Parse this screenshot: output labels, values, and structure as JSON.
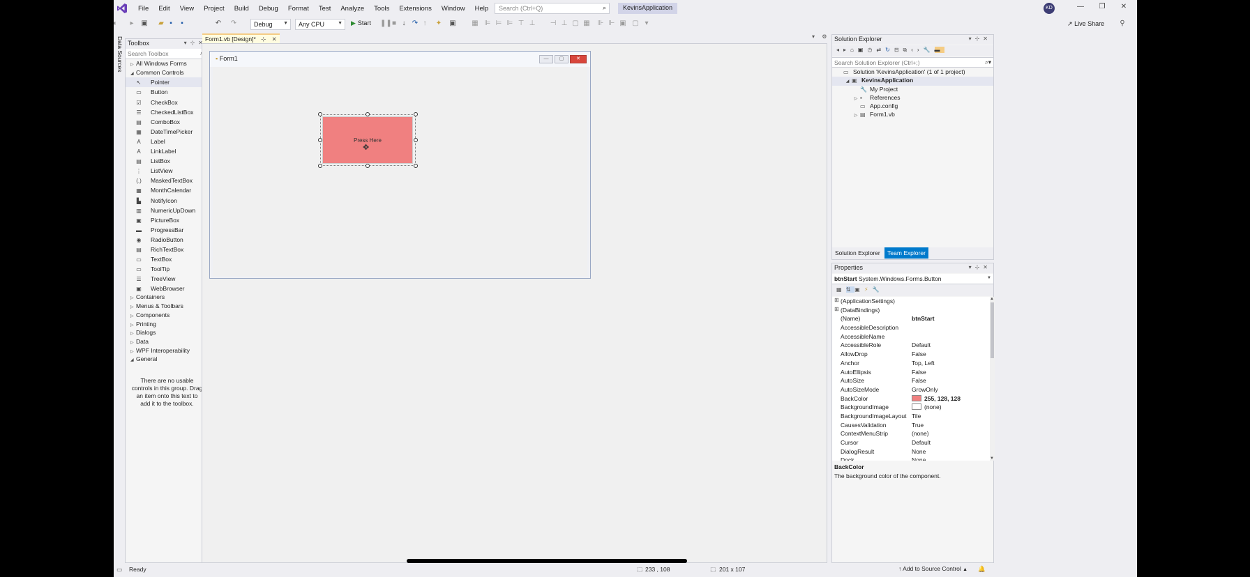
{
  "titlebar": {
    "menu": [
      "File",
      "Edit",
      "View",
      "Project",
      "Build",
      "Debug",
      "Format",
      "Test",
      "Analyze",
      "Tools",
      "Extensions",
      "Window",
      "Help"
    ],
    "search_placeholder": "Search (Ctrl+Q)",
    "project_name": "KevinsApplication",
    "avatar_initials": "KD"
  },
  "toolbar": {
    "config": "Debug",
    "platform": "Any CPU",
    "start_label": "Start",
    "live_share": "Live Share"
  },
  "leftstrip": {
    "label": "Data Sources"
  },
  "toolbox": {
    "title": "Toolbox",
    "search_placeholder": "Search Toolbox",
    "categories_top": [
      {
        "label": "All Windows Forms",
        "expanded": false
      },
      {
        "label": "Common Controls",
        "expanded": true
      }
    ],
    "items": [
      {
        "label": "Pointer",
        "icon": "pointer-icon",
        "glyph": "↖"
      },
      {
        "label": "Button",
        "icon": "button-icon",
        "glyph": "▭"
      },
      {
        "label": "CheckBox",
        "icon": "checkbox-icon",
        "glyph": "☑"
      },
      {
        "label": "CheckedListBox",
        "icon": "checkedlistbox-icon",
        "glyph": "☰"
      },
      {
        "label": "ComboBox",
        "icon": "combobox-icon",
        "glyph": "▤"
      },
      {
        "label": "DateTimePicker",
        "icon": "datetimepicker-icon",
        "glyph": "▦"
      },
      {
        "label": "Label",
        "icon": "label-icon",
        "glyph": "A"
      },
      {
        "label": "LinkLabel",
        "icon": "linklabel-icon",
        "glyph": "A"
      },
      {
        "label": "ListBox",
        "icon": "listbox-icon",
        "glyph": "▤"
      },
      {
        "label": "ListView",
        "icon": "listview-icon",
        "glyph": "⋮"
      },
      {
        "label": "MaskedTextBox",
        "icon": "maskedtextbox-icon",
        "glyph": "(.)"
      },
      {
        "label": "MonthCalendar",
        "icon": "monthcalendar-icon",
        "glyph": "▦"
      },
      {
        "label": "NotifyIcon",
        "icon": "notifyicon-icon",
        "glyph": "▙"
      },
      {
        "label": "NumericUpDown",
        "icon": "numericupdown-icon",
        "glyph": "▥"
      },
      {
        "label": "PictureBox",
        "icon": "picturebox-icon",
        "glyph": "▣"
      },
      {
        "label": "ProgressBar",
        "icon": "progressbar-icon",
        "glyph": "▬"
      },
      {
        "label": "RadioButton",
        "icon": "radiobutton-icon",
        "glyph": "◉"
      },
      {
        "label": "RichTextBox",
        "icon": "richtextbox-icon",
        "glyph": "▤"
      },
      {
        "label": "TextBox",
        "icon": "textbox-icon",
        "glyph": "▭"
      },
      {
        "label": "ToolTip",
        "icon": "tooltip-icon",
        "glyph": "▭"
      },
      {
        "label": "TreeView",
        "icon": "treeview-icon",
        "glyph": "☰"
      },
      {
        "label": "WebBrowser",
        "icon": "webbrowser-icon",
        "glyph": "▣"
      }
    ],
    "categories_bottom": [
      {
        "label": "Containers",
        "expanded": false
      },
      {
        "label": "Menus & Toolbars",
        "expanded": false
      },
      {
        "label": "Components",
        "expanded": false
      },
      {
        "label": "Printing",
        "expanded": false
      },
      {
        "label": "Dialogs",
        "expanded": false
      },
      {
        "label": "Data",
        "expanded": false
      },
      {
        "label": "WPF Interoperability",
        "expanded": false
      },
      {
        "label": "General",
        "expanded": true
      }
    ],
    "general_note": "There are no usable controls in this group. Drag an item onto this text to add it to the toolbox."
  },
  "document": {
    "tab_label": "Form1.vb [Design]*",
    "form_title": "Form1",
    "button_text": "Press Here",
    "button_color": "#f08080"
  },
  "solution_explorer": {
    "title": "Solution Explorer",
    "search_placeholder": "Search Solution Explorer (Ctrl+;)",
    "nodes": [
      {
        "label": "Solution 'KevinsApplication' (1 of 1 project)",
        "level": 0,
        "tri": "",
        "icon": "▭"
      },
      {
        "label": "KevinsApplication",
        "level": 1,
        "tri": "◢",
        "icon": "▣",
        "selected": true
      },
      {
        "label": "My Project",
        "level": 2,
        "tri": "",
        "icon": "🔧"
      },
      {
        "label": "References",
        "level": 2,
        "tri": "▷",
        "icon": "▪"
      },
      {
        "label": "App.config",
        "level": 2,
        "tri": "",
        "icon": "▭"
      },
      {
        "label": "Form1.vb",
        "level": 2,
        "tri": "▷",
        "icon": "▤"
      }
    ],
    "bottom_tabs": [
      "Solution Explorer",
      "Team Explorer"
    ]
  },
  "properties": {
    "title": "Properties",
    "object_name": "btnStart",
    "object_type": "System.Windows.Forms.Button",
    "rows": [
      {
        "key": "(ApplicationSettings)",
        "value": "",
        "expand": "⊞"
      },
      {
        "key": "(DataBindings)",
        "value": "",
        "expand": "⊞"
      },
      {
        "key": "(Name)",
        "value": "btnStart",
        "bold": true
      },
      {
        "key": "AccessibleDescription",
        "value": ""
      },
      {
        "key": "AccessibleName",
        "value": ""
      },
      {
        "key": "AccessibleRole",
        "value": "Default"
      },
      {
        "key": "AllowDrop",
        "value": "False"
      },
      {
        "key": "Anchor",
        "value": "Top, Left"
      },
      {
        "key": "AutoEllipsis",
        "value": "False"
      },
      {
        "key": "AutoSize",
        "value": "False"
      },
      {
        "key": "AutoSizeMode",
        "value": "GrowOnly"
      },
      {
        "key": "BackColor",
        "value": "255, 128, 128",
        "bold": true,
        "swatch": "#f08080"
      },
      {
        "key": "BackgroundImage",
        "value": "(none)",
        "swatch": "#ffffff"
      },
      {
        "key": "BackgroundImageLayout",
        "value": "Tile"
      },
      {
        "key": "CausesValidation",
        "value": "True"
      },
      {
        "key": "ContextMenuStrip",
        "value": "(none)"
      },
      {
        "key": "Cursor",
        "value": "Default"
      },
      {
        "key": "DialogResult",
        "value": "None"
      },
      {
        "key": "Dock",
        "value": "None"
      }
    ],
    "desc_title": "BackColor",
    "desc_text": "The background color of the component."
  },
  "statusbar": {
    "status": "Ready",
    "position": "233 , 108",
    "size": "201 x 107",
    "source_control": "Add to Source Control"
  }
}
